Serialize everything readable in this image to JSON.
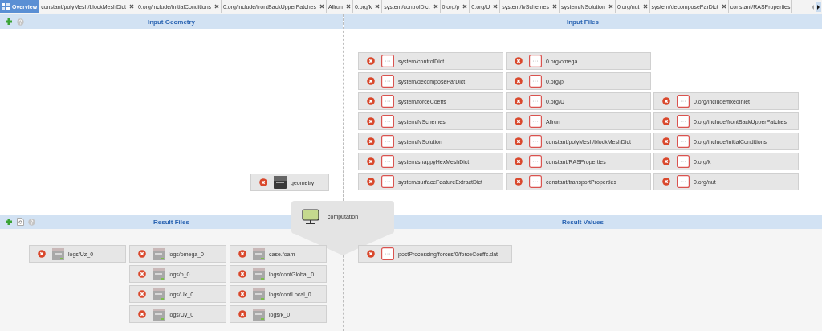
{
  "tabs": [
    {
      "label": "Overview",
      "selected": true,
      "closable": false
    },
    {
      "label": "constant/polyMesh/blockMeshDict",
      "selected": false,
      "closable": true
    },
    {
      "label": "0.org/include/initialConditions",
      "selected": false,
      "closable": true
    },
    {
      "label": "0.org/include/frontBackUpperPatches",
      "selected": false,
      "closable": true
    },
    {
      "label": "Allrun",
      "selected": false,
      "closable": true
    },
    {
      "label": "0.org/k",
      "selected": false,
      "closable": true
    },
    {
      "label": "system/controlDict",
      "selected": false,
      "closable": true
    },
    {
      "label": "0.org/p",
      "selected": false,
      "closable": true
    },
    {
      "label": "0.org/U",
      "selected": false,
      "closable": true
    },
    {
      "label": "system/fvSchemes",
      "selected": false,
      "closable": true
    },
    {
      "label": "system/fvSolution",
      "selected": false,
      "closable": true
    },
    {
      "label": "0.org/nut",
      "selected": false,
      "closable": true
    },
    {
      "label": "system/decomposeParDict",
      "selected": false,
      "closable": true
    },
    {
      "label": "constant/RASProperties",
      "selected": false,
      "closable": false
    }
  ],
  "input_geometry": {
    "title": "Input Geometry",
    "items": [
      {
        "label": "geometry",
        "kind": "geometry"
      }
    ]
  },
  "input_files": {
    "title": "Input Files",
    "columns": [
      [
        {
          "label": "system/controlDict",
          "kind": "file"
        },
        {
          "label": "system/decomposeParDict",
          "kind": "file"
        },
        {
          "label": "system/forceCoeffs",
          "kind": "file"
        },
        {
          "label": "system/fvSchemes",
          "kind": "file"
        },
        {
          "label": "system/fvSolution",
          "kind": "file"
        },
        {
          "label": "system/snappyHexMeshDict",
          "kind": "file"
        },
        {
          "label": "system/surfaceFeatureExtractDict",
          "kind": "file"
        }
      ],
      [
        {
          "label": "0.org/omega",
          "kind": "file"
        },
        {
          "label": "0.org/p",
          "kind": "file"
        },
        {
          "label": "0.org/U",
          "kind": "file"
        },
        {
          "label": "Allrun",
          "kind": "file"
        },
        {
          "label": "constant/polyMesh/blockMeshDict",
          "kind": "file"
        },
        {
          "label": "constant/RASProperties",
          "kind": "file"
        },
        {
          "label": "constant/transportProperties",
          "kind": "file"
        }
      ],
      [
        {
          "label": "0.org/include/fixedInlet",
          "kind": "file"
        },
        {
          "label": "0.org/include/frontBackUpperPatches",
          "kind": "file"
        },
        {
          "label": "0.org/include/initialConditions",
          "kind": "file"
        },
        {
          "label": "0.org/k",
          "kind": "file"
        },
        {
          "label": "0.org/nut",
          "kind": "file"
        }
      ]
    ]
  },
  "computation": {
    "label": "computation"
  },
  "result_files": {
    "title": "Result Files",
    "columns": [
      [
        {
          "label": "logs/Uz_0",
          "kind": "log"
        }
      ],
      [
        {
          "label": "logs/omega_0",
          "kind": "log"
        },
        {
          "label": "logs/p_0",
          "kind": "log"
        },
        {
          "label": "logs/Ux_0",
          "kind": "log"
        },
        {
          "label": "logs/Uy_0",
          "kind": "log"
        }
      ],
      [
        {
          "label": "case.foam",
          "kind": "log"
        },
        {
          "label": "logs/contGlobal_0",
          "kind": "log"
        },
        {
          "label": "logs/contLocal_0",
          "kind": "log"
        },
        {
          "label": "logs/k_0",
          "kind": "log"
        }
      ]
    ]
  },
  "result_values": {
    "title": "Result Values",
    "items": [
      {
        "label": "postProcessing/forces/0/forceCoeffs.dat",
        "kind": "file"
      }
    ]
  }
}
